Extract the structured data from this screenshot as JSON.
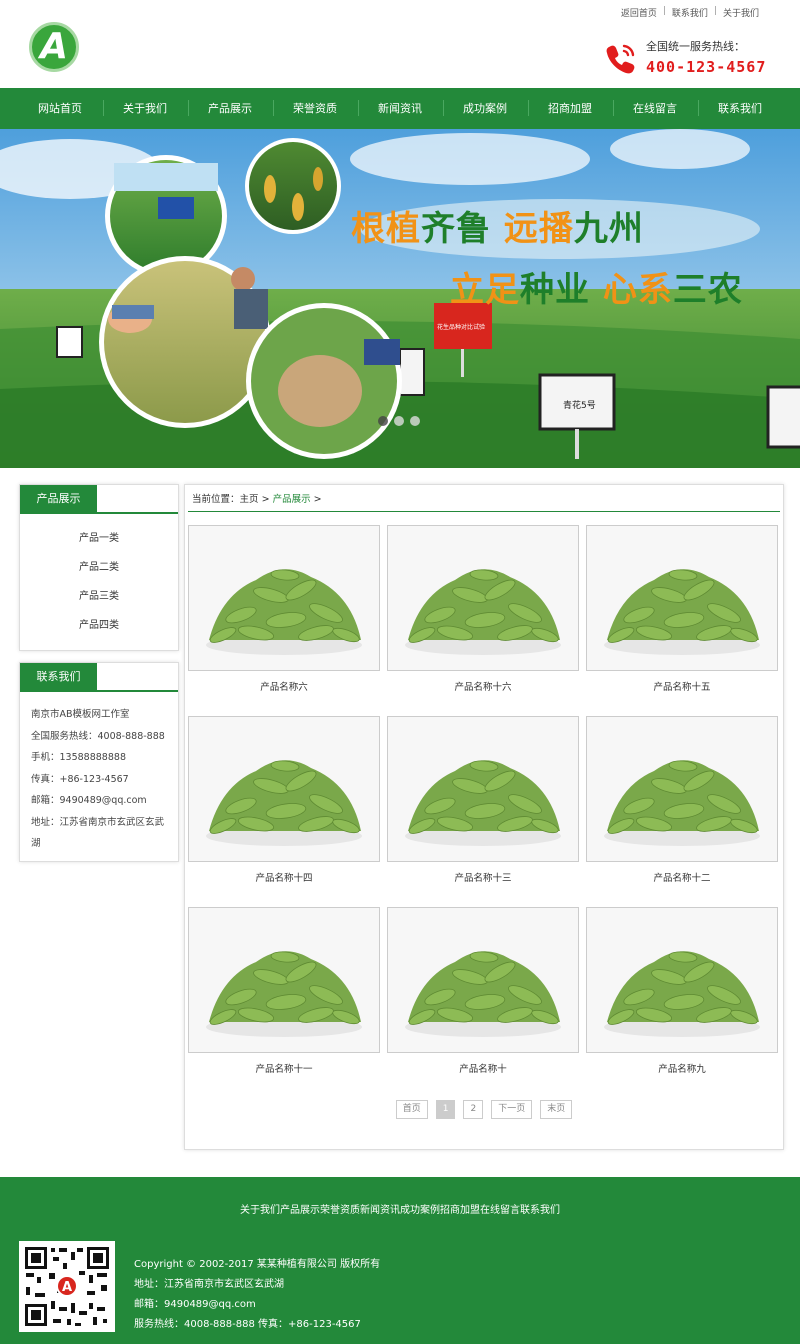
{
  "header": {
    "top_links": [
      "返回首页",
      "联系我们",
      "关于我们"
    ],
    "logo_letter": "A",
    "hotline_label": "全国统一服务热线：",
    "hotline_number": "400-123-4567"
  },
  "nav": [
    "网站首页",
    "关于我们",
    "产品展示",
    "荣誉资质",
    "新闻资讯",
    "成功案例",
    "招商加盟",
    "在线留言",
    "联系我们"
  ],
  "banner": {
    "line1": {
      "a": "根植",
      "b": "齐鲁",
      "c": "远播",
      "d": "九州"
    },
    "line2": {
      "a": "立足",
      "b": "种业",
      "c": "心系",
      "d": "三农"
    },
    "sign_text": "花生品种对比试验",
    "post_text": "青花5号"
  },
  "sidebar": {
    "products_title": "产品展示",
    "categories": [
      "产品一类",
      "产品二类",
      "产品三类",
      "产品四类"
    ],
    "contact_title": "联系我们",
    "contact_lines": [
      "南京市AB模板网工作室",
      "全国服务热线：4008-888-888",
      "手机：13588888888",
      "传真：+86-123-4567",
      "邮箱：9490489@qq.com",
      "地址：江苏省南京市玄武区玄武湖"
    ]
  },
  "breadcrumb": {
    "prefix": "当前位置：",
    "home": "主页",
    "sep": ">",
    "current": "产品展示"
  },
  "products": [
    "产品名称六",
    "产品名称十六",
    "产品名称十五",
    "产品名称十四",
    "产品名称十三",
    "产品名称十二",
    "产品名称十一",
    "产品名称十",
    "产品名称九"
  ],
  "pagination": [
    "首页",
    "1",
    "2",
    "下一页",
    "末页"
  ],
  "footer": {
    "nav": [
      "关于我们",
      "产品展示",
      "荣誉资质",
      "新闻资讯",
      "成功案例",
      "招商加盟",
      "在线留言",
      "联系我们"
    ],
    "copyright": "Copyright © 2002-2017 某某种植有限公司 版权所有",
    "address": "地址：江苏省南京市玄武区玄武湖",
    "email": "邮箱：9490489@qq.com",
    "phone": "服务热线：4008-888-888 传真：+86-123-4567"
  },
  "colors": {
    "brand_green": "#23893a",
    "hotline_red": "#e11d1d",
    "slogan_orange": "#f19216"
  }
}
